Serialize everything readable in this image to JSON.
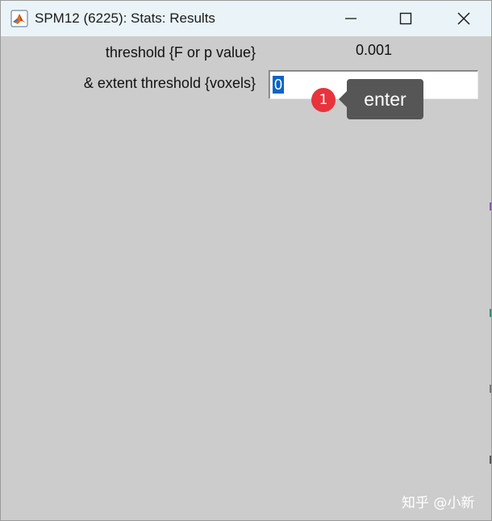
{
  "window": {
    "title": "SPM12 (6225): Stats: Results",
    "app_icon": "matlab-icon",
    "controls": {
      "minimize_icon": "minimize-icon",
      "maximize_icon": "maximize-icon",
      "close_icon": "close-icon"
    }
  },
  "form": {
    "threshold_label": "threshold {F or p value}",
    "threshold_value": "0.001",
    "extent_label": "& extent threshold {voxels}",
    "extent_value": "0"
  },
  "annotation": {
    "step_number": "1",
    "tooltip_text": "enter",
    "badge_color": "#e8333c",
    "tooltip_color": "#565656"
  },
  "watermark": "知乎 @小新",
  "colors": {
    "background": "#cccccc",
    "titlebar": "#eaf4f8",
    "selection": "#0a64c8"
  }
}
